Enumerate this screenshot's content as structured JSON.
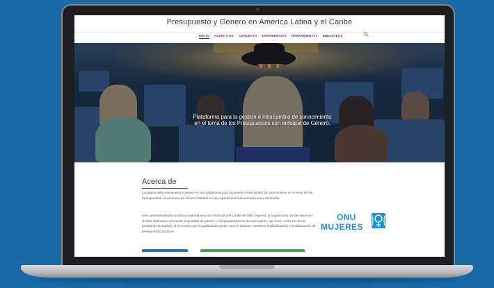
{
  "site": {
    "title": "Presupuesto y Género en América Latina y el Caribe",
    "nav": [
      "INICIO",
      "ACERCA DE",
      "CONCEPTO",
      "EXPERIENCIAS",
      "HERRAMIENTAS",
      "BIBLIOTECA"
    ],
    "active_nav": "INICIO",
    "search_icon": "search-icon"
  },
  "hero": {
    "line1": "Plataforma para la gestión e intercambio de conocimiento",
    "line2": "en el tema de los Presupuestos con enfoque de Género."
  },
  "about": {
    "heading": "Acerca de",
    "p1": "La página web presupuesto y género es una plataforma para la gestión e intercambio de conocimiento en el tema de los Presupuestos con enfoque de Género, basada en las experiencias latinoamericanas y del Caribe.",
    "p2": "Está administrada por la oficina regional para las Américas y el Caribe de ONU Mujeres, la organización de las Naciones Unidas dedicada a promover la igualdad de género y el empoderamiento de las mujeres, que tiene, entre sus áreas prioritarias de trabajo, el promover que la igualdad de género sea un aspecto central en la planificación y la elaboración de presupuestos públicos."
  },
  "logo": {
    "line1": "ONU",
    "line2": "MUJERES",
    "color": "#1e8fd6"
  },
  "colors": {
    "background": "#1a6aa8",
    "nav_accent": "#6b3a7a"
  }
}
